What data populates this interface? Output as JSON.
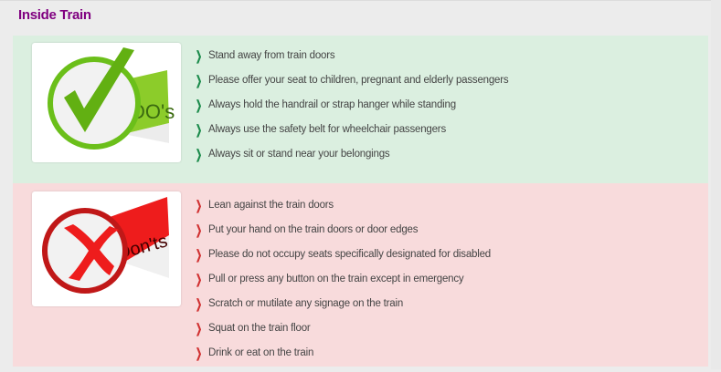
{
  "title": "Inside Train",
  "colors": {
    "title": "#800080",
    "dos_bg": "#dbefe0",
    "donts_bg": "#f8dbdc",
    "dos_arrow": "#1a8a4a",
    "donts_arrow": "#d03030"
  },
  "dos": {
    "badge_text": "DO's",
    "icon": "checkmark-icon",
    "items": [
      "Stand away from train doors",
      "Please offer your seat to children, pregnant and elderly passengers",
      "Always hold the handrail or strap hanger while standing",
      "Always use the safety belt for wheelchair passengers",
      "Always sit or stand near your belongings"
    ]
  },
  "donts": {
    "badge_text": "Don'ts",
    "icon": "cross-icon",
    "items": [
      "Lean against the train doors",
      "Put your hand on the train doors or door edges",
      "Please do not occupy seats specifically designated for disabled",
      "Pull or press any button on the train except in emergency",
      "Scratch or mutilate any signage on the train",
      "Squat on the train floor",
      "Drink or eat on the train"
    ]
  }
}
